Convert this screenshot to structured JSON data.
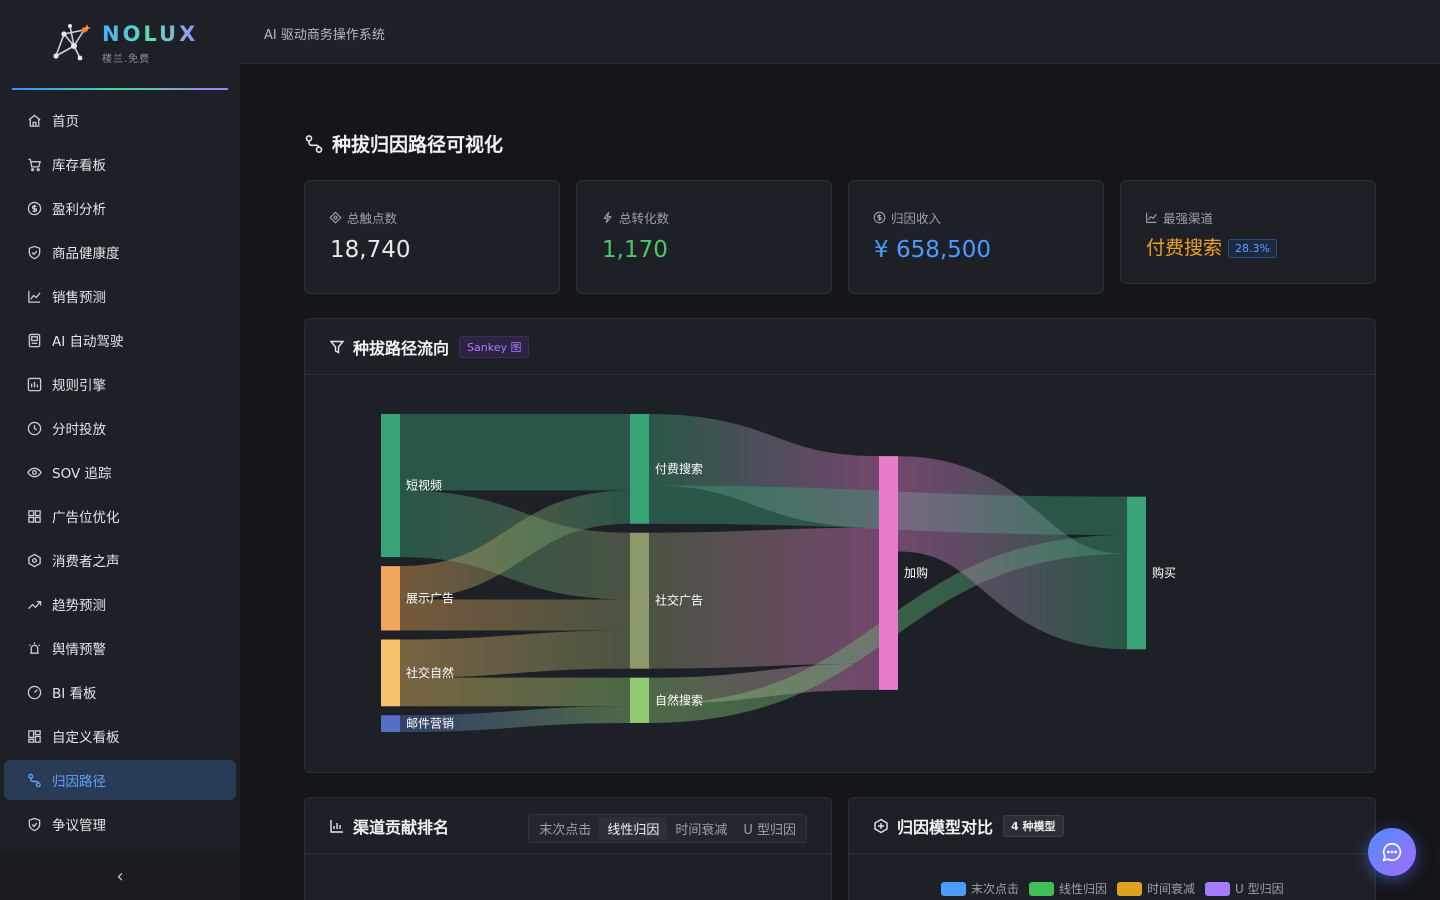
{
  "app": {
    "name": "NOLUX",
    "subtitle": "楼兰.免费",
    "header_title": "AI 驱动商务操作系统"
  },
  "sidebar": {
    "items": [
      {
        "label": "首页",
        "icon": "home-icon"
      },
      {
        "label": "库存看板",
        "icon": "cart-icon"
      },
      {
        "label": "盈利分析",
        "icon": "dollar-icon"
      },
      {
        "label": "商品健康度",
        "icon": "shield-check-icon"
      },
      {
        "label": "销售预测",
        "icon": "line-chart-icon"
      },
      {
        "label": "AI 自动驾驶",
        "icon": "robot-icon"
      },
      {
        "label": "规则引擎",
        "icon": "rules-icon"
      },
      {
        "label": "分时投放",
        "icon": "clock-icon"
      },
      {
        "label": "SOV 追踪",
        "icon": "eye-icon"
      },
      {
        "label": "广告位优化",
        "icon": "grid-icon"
      },
      {
        "label": "消费者之声",
        "icon": "voice-icon"
      },
      {
        "label": "趋势预测",
        "icon": "trend-icon"
      },
      {
        "label": "舆情预警",
        "icon": "alarm-icon"
      },
      {
        "label": "BI 看板",
        "icon": "dashboard-icon"
      },
      {
        "label": "自定义看板",
        "icon": "layout-icon"
      },
      {
        "label": "归因路径",
        "icon": "path-icon",
        "active": true
      },
      {
        "label": "争议管理",
        "icon": "shield-icon"
      }
    ],
    "collapse_glyph": "‹"
  },
  "page": {
    "title": "种拔归因路径可视化"
  },
  "kpis": [
    {
      "label": "总触点数",
      "value": "18,740",
      "icon": "target-icon",
      "color": "#e6e8ec"
    },
    {
      "label": "总转化数",
      "value": "1,170",
      "icon": "bolt-icon",
      "color": "#4cc76a"
    },
    {
      "label": "归因收入",
      "value": "¥ 658,500",
      "icon": "dollar-icon",
      "color": "#4a9dff"
    },
    {
      "label": "最强渠道",
      "value": "付费搜索",
      "badge": "28.3%",
      "icon": "chart-icon",
      "color": "#f0a020"
    }
  ],
  "sankey_card": {
    "title": "种拔路径流向",
    "tag": "Sankey 图"
  },
  "chart_data": {
    "type": "sankey",
    "nodes": [
      {
        "name": "短视频",
        "column": 0,
        "color": "#3aa277"
      },
      {
        "name": "展示广告",
        "column": 0,
        "color": "#f0a55a"
      },
      {
        "name": "社交自然",
        "column": 0,
        "color": "#f5c26a"
      },
      {
        "name": "邮件营销",
        "column": 0,
        "color": "#5470c6"
      },
      {
        "name": "付费搜索",
        "column": 1,
        "color": "#3aa277"
      },
      {
        "name": "社交广告",
        "column": 1,
        "color": "#8a9a6a"
      },
      {
        "name": "自然搜索",
        "column": 1,
        "color": "#91cc75"
      },
      {
        "name": "加购",
        "column": 2,
        "color": "#e87ccc"
      },
      {
        "name": "购买",
        "column": 3,
        "color": "#3aa277"
      }
    ],
    "links": [
      {
        "source": "短视频",
        "target": "付费搜索",
        "value": 3200
      },
      {
        "source": "短视频",
        "target": "社交广告",
        "value": 2800
      },
      {
        "source": "展示广告",
        "target": "付费搜索",
        "value": 1400
      },
      {
        "source": "展示广告",
        "target": "社交广告",
        "value": 1300
      },
      {
        "source": "社交自然",
        "target": "社交广告",
        "value": 1600
      },
      {
        "source": "社交自然",
        "target": "自然搜索",
        "value": 1200
      },
      {
        "source": "邮件营销",
        "target": "自然搜索",
        "value": 700
      },
      {
        "source": "付费搜索",
        "target": "加购",
        "value": 3000
      },
      {
        "source": "付费搜索",
        "target": "购买",
        "value": 1600
      },
      {
        "source": "社交广告",
        "target": "加购",
        "value": 5700
      },
      {
        "source": "自然搜索",
        "target": "加购",
        "value": 1100
      },
      {
        "source": "自然搜索",
        "target": "购买",
        "value": 800
      },
      {
        "source": "加购",
        "target": "购买",
        "value": 4000
      }
    ]
  },
  "rank_card": {
    "title": "渠道贡献排名",
    "tabs": [
      {
        "label": "末次点击",
        "active": false
      },
      {
        "label": "线性归因",
        "active": true
      },
      {
        "label": "时间衰减",
        "active": false
      },
      {
        "label": "U 型归因",
        "active": false
      }
    ]
  },
  "compare_card": {
    "title": "归因模型对比",
    "tag": "4 种模型",
    "legend": [
      {
        "label": "末次点击",
        "color": "#4a9dff"
      },
      {
        "label": "线性归因",
        "color": "#3fbf58"
      },
      {
        "label": "时间衰减",
        "color": "#e0a020"
      },
      {
        "label": "U 型归因",
        "color": "#a77bff"
      }
    ]
  }
}
